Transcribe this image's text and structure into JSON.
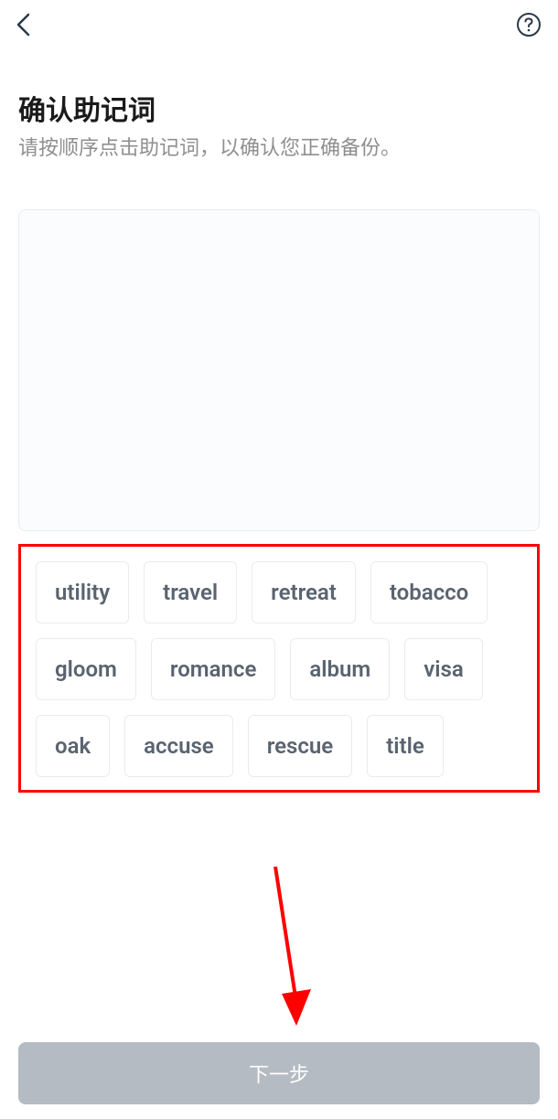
{
  "header": {
    "back_icon": "back",
    "help_icon": "help"
  },
  "title": "确认助记词",
  "subtitle": "请按顺序点击助记词，以确认您正确备份。",
  "words": [
    [
      "utility",
      "travel",
      "retreat",
      "tobacco"
    ],
    [
      "gloom",
      "romance",
      "album",
      "visa"
    ],
    [
      "oak",
      "accuse",
      "rescue",
      "title"
    ]
  ],
  "next_button": "下一步",
  "annotations": {
    "highlight_box_color": "#ff0000",
    "arrow_color": "#ff0000"
  }
}
